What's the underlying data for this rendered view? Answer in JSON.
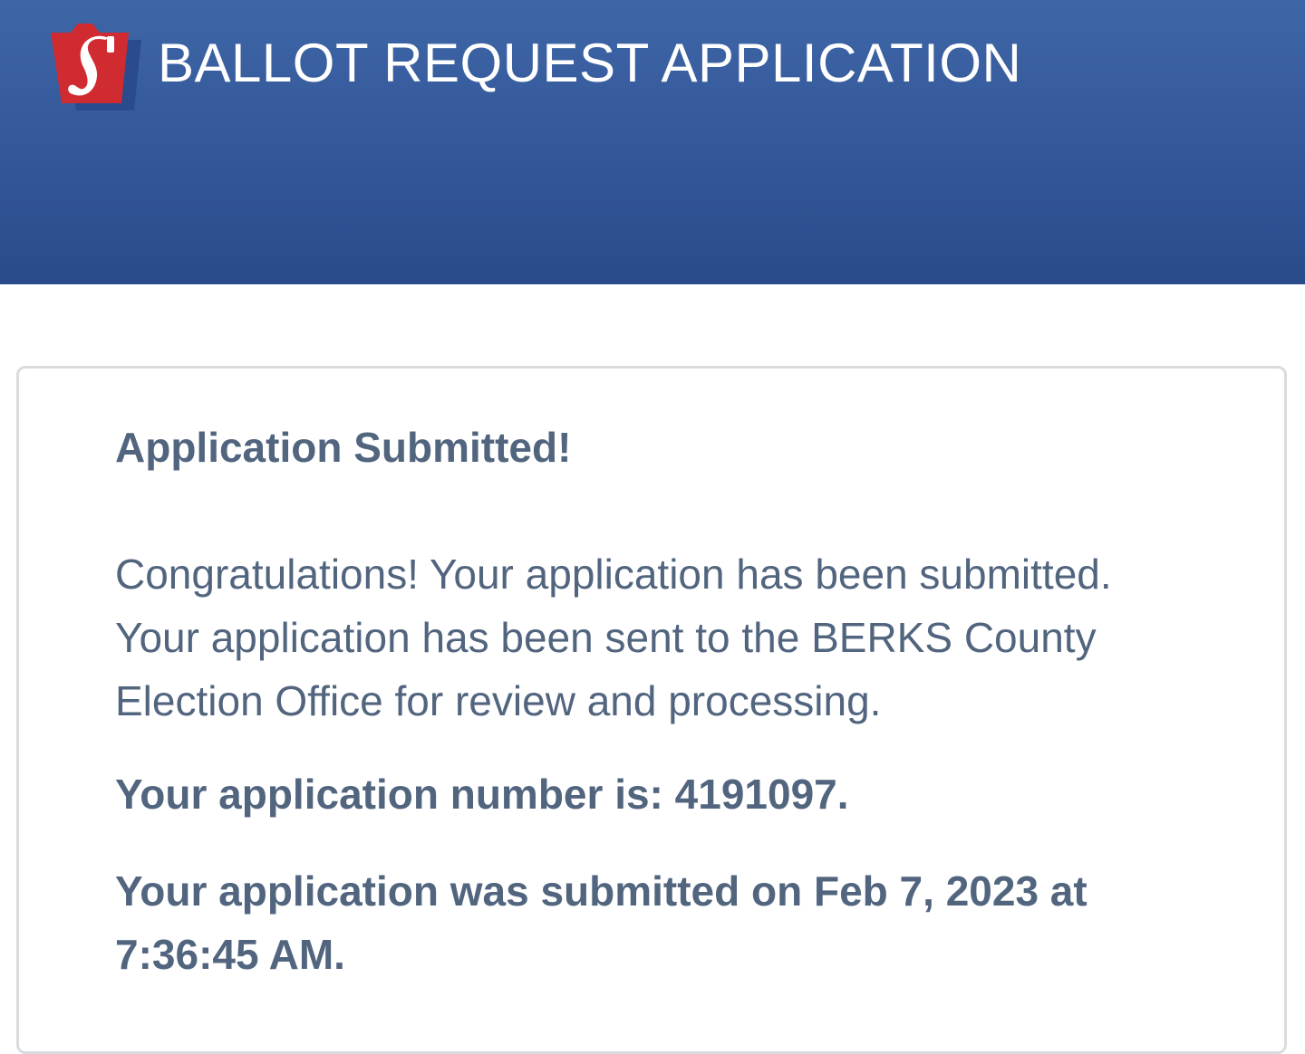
{
  "header": {
    "title": "BALLOT REQUEST APPLICATION",
    "logo_icon": "pa-keystone-logo-icon",
    "background_color": "#3a61a2",
    "text_color": "#ffffff"
  },
  "confirmation": {
    "heading": "Application Submitted!",
    "message": "Congratulations! Your application has been submitted. Your application has been sent to the BERKS County Election Office for review and processing.",
    "application_number_text": "Your application number is: 4191097.",
    "submitted_on_text": "Your application was submitted on Feb 7, 2023 at 7:36:45 AM.",
    "text_color": "#52657f"
  }
}
